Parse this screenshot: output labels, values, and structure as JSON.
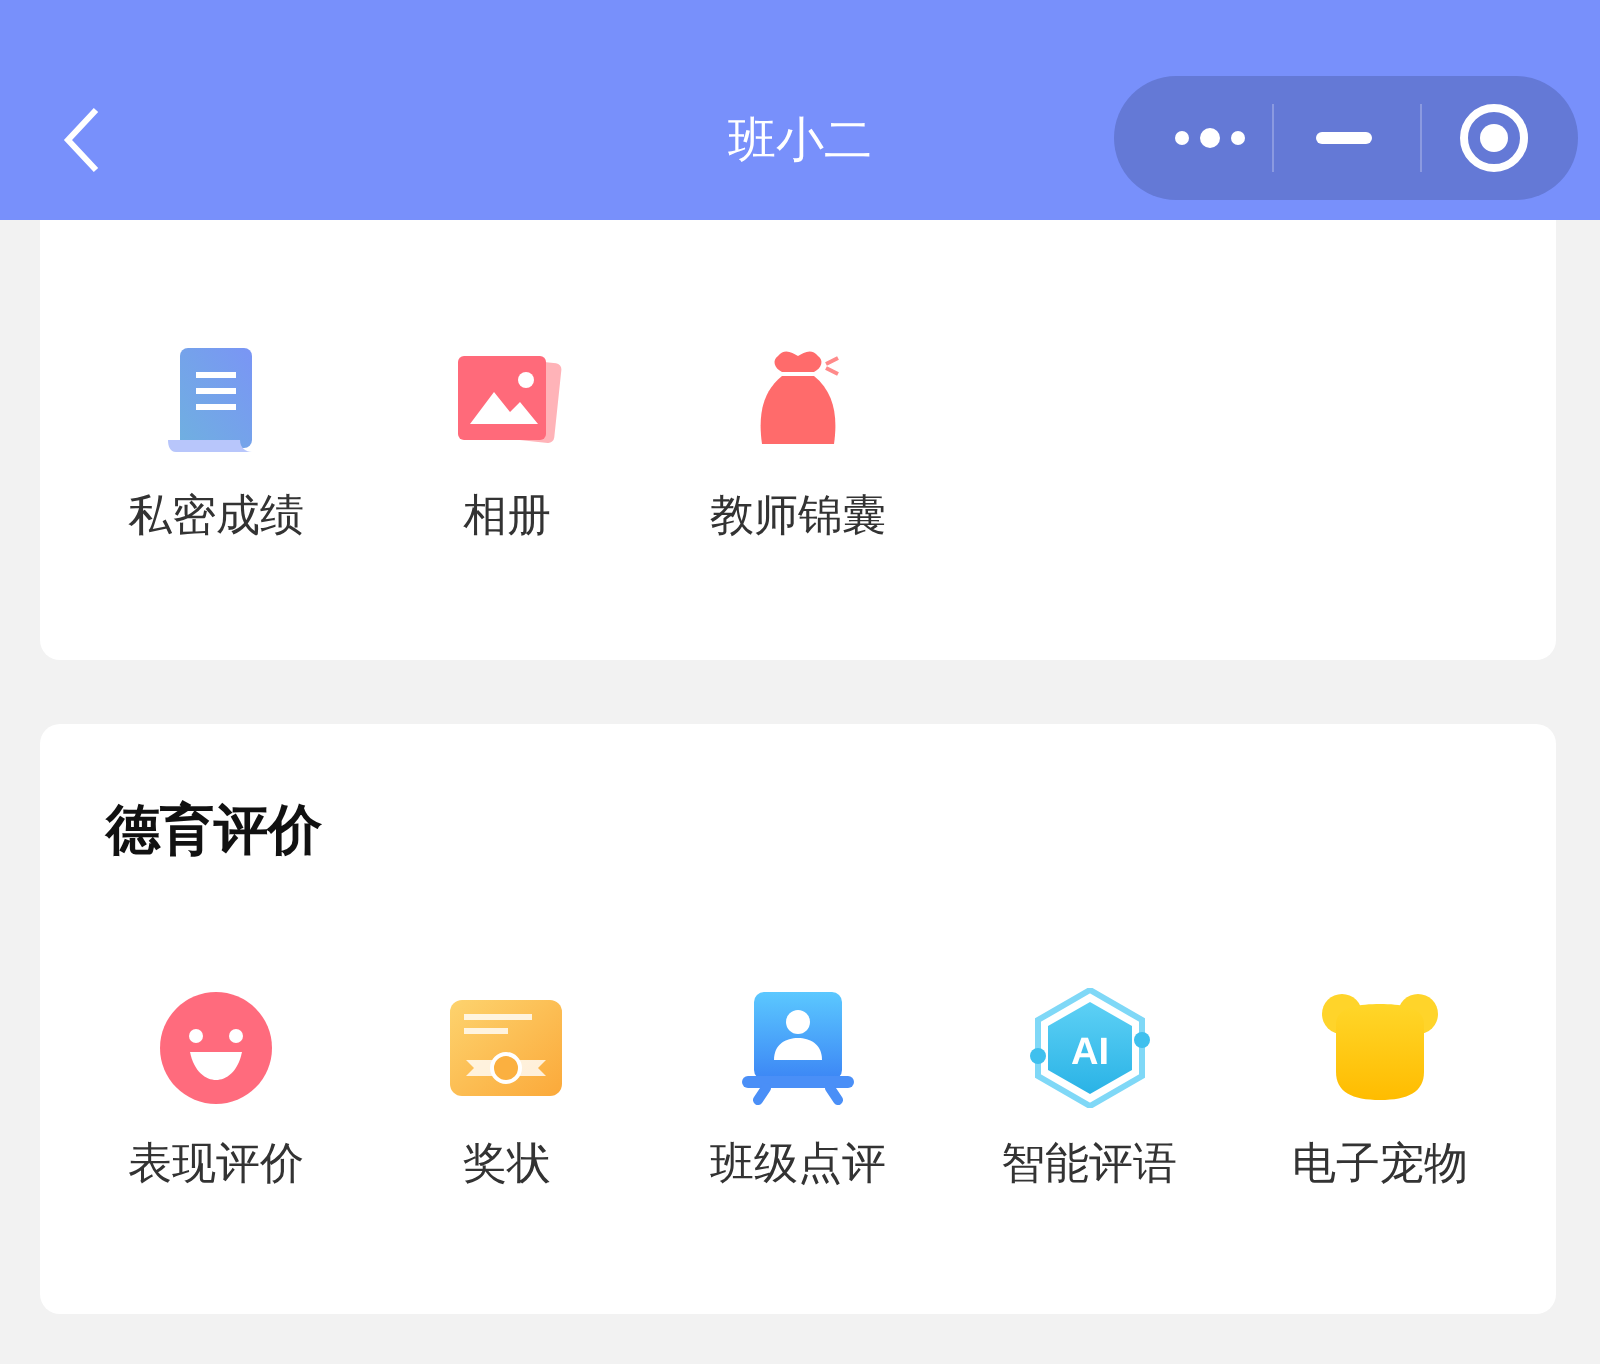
{
  "header": {
    "title": "班小二"
  },
  "top_card": {
    "items": [
      {
        "label": "私密成绩",
        "kind": "scroll"
      },
      {
        "label": "相册",
        "kind": "photo"
      },
      {
        "label": "教师锦囊",
        "kind": "bag"
      }
    ]
  },
  "moral_card": {
    "title": "德育评价",
    "items": [
      {
        "label": "表现评价",
        "kind": "smile"
      },
      {
        "label": "奖状",
        "kind": "certificate"
      },
      {
        "label": "班级点评",
        "kind": "presenter"
      },
      {
        "label": "智能评语",
        "kind": "ai",
        "icon_text": "AI"
      },
      {
        "label": "电子宠物",
        "kind": "bear"
      }
    ]
  }
}
